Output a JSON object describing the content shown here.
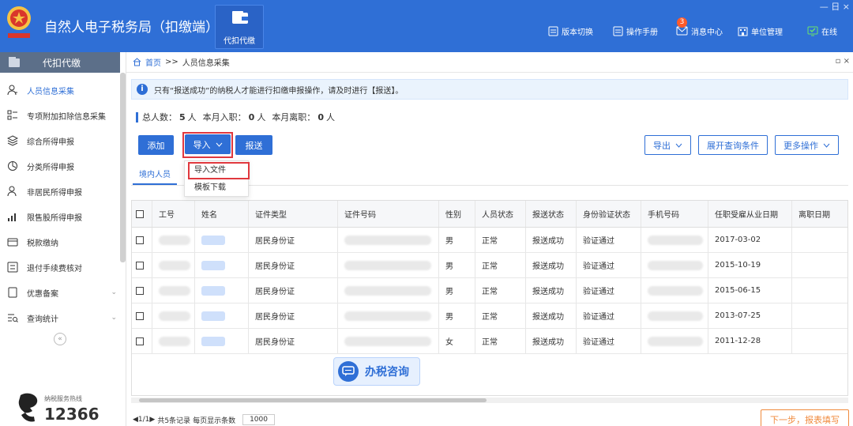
{
  "app": {
    "title": "自然人电子税务局（扣缴端）",
    "module_button": "代扣代缴",
    "window_controls": "— 日 ×"
  },
  "toolbar": {
    "items": [
      {
        "label": "版本切换",
        "icon": "version-icon"
      },
      {
        "label": "操作手册",
        "icon": "manual-icon"
      },
      {
        "label": "消息中心",
        "icon": "message-icon",
        "badge": "3"
      },
      {
        "label": "单位管理",
        "icon": "company-icon"
      },
      {
        "label": "在线",
        "icon": "online-icon"
      }
    ]
  },
  "sidebar": {
    "header": "代扣代缴",
    "items": [
      {
        "label": "人员信息采集",
        "icon": "person-icon",
        "active": true
      },
      {
        "label": "专项附加扣除信息采集",
        "icon": "list-icon"
      },
      {
        "label": "综合所得申报",
        "icon": "layers-icon"
      },
      {
        "label": "分类所得申报",
        "icon": "pie-icon"
      },
      {
        "label": "非居民所得申报",
        "icon": "person-outline-icon"
      },
      {
        "label": "限售股所得申报",
        "icon": "bars-icon"
      },
      {
        "label": "税款缴纳",
        "icon": "wallet-icon"
      },
      {
        "label": "退付手续费核对",
        "icon": "checklist-icon"
      },
      {
        "label": "优惠备案",
        "icon": "file-icon",
        "expandable": true
      },
      {
        "label": "查询统计",
        "icon": "query-icon",
        "expandable": true
      }
    ],
    "hotline_label": "纳税服务热线",
    "hotline_number": "12366"
  },
  "breadcrumb": {
    "home": "首页",
    "separator": ">>",
    "current": "人员信息采集",
    "controls": "▫ ×"
  },
  "notice": {
    "icon": "info-icon",
    "text": "只有“报送成功”的纳税人才能进行扣缴申报操作，请及时进行【报送】。"
  },
  "stats": {
    "total_label": "总人数：",
    "total_value": "5",
    "total_unit": "人",
    "joined_label": "本月入职：",
    "joined_value": "0",
    "joined_unit": "人",
    "left_label": "本月离职：",
    "left_value": "0",
    "left_unit": "人"
  },
  "actions": {
    "add": "添加",
    "import": "导入",
    "submit": "报送",
    "export": "导出",
    "expand_query": "展开查询条件",
    "more": "更多操作"
  },
  "import_menu": {
    "items": [
      "导入文件",
      "模板下载"
    ]
  },
  "subtab": "境内人员",
  "table": {
    "columns": [
      "工号",
      "姓名",
      "证件类型",
      "证件号码",
      "性别",
      "人员状态",
      "报送状态",
      "身份验证状态",
      "手机号码",
      "任职受雇从业日期",
      "离职日期"
    ],
    "rows": [
      {
        "id_type": "居民身份证",
        "gender": "男",
        "status": "正常",
        "submit_status": "报送成功",
        "verify": "验证通过",
        "hire_date": "2017-03-02",
        "leave_date": ""
      },
      {
        "id_type": "居民身份证",
        "gender": "男",
        "status": "正常",
        "submit_status": "报送成功",
        "verify": "验证通过",
        "hire_date": "2015-10-19",
        "leave_date": ""
      },
      {
        "id_type": "居民身份证",
        "gender": "男",
        "status": "正常",
        "submit_status": "报送成功",
        "verify": "验证通过",
        "hire_date": "2015-06-15",
        "leave_date": ""
      },
      {
        "id_type": "居民身份证",
        "gender": "男",
        "status": "正常",
        "submit_status": "报送成功",
        "verify": "验证通过",
        "hire_date": "2013-07-25",
        "leave_date": ""
      },
      {
        "id_type": "居民身份证",
        "gender": "女",
        "status": "正常",
        "submit_status": "报送成功",
        "verify": "验证通过",
        "hire_date": "2011-12-28",
        "leave_date": ""
      }
    ]
  },
  "consult_button": "办税咨询",
  "pager": {
    "nav": "◀1/1▶",
    "summary": "共5条记录",
    "page_size_label": "每页显示条数",
    "page_size": "1000"
  },
  "next_button": "下一步，报表填写",
  "colors": {
    "primary": "#2f6fd6",
    "highlight": "#e0383e",
    "warning": "#f08a3c"
  }
}
